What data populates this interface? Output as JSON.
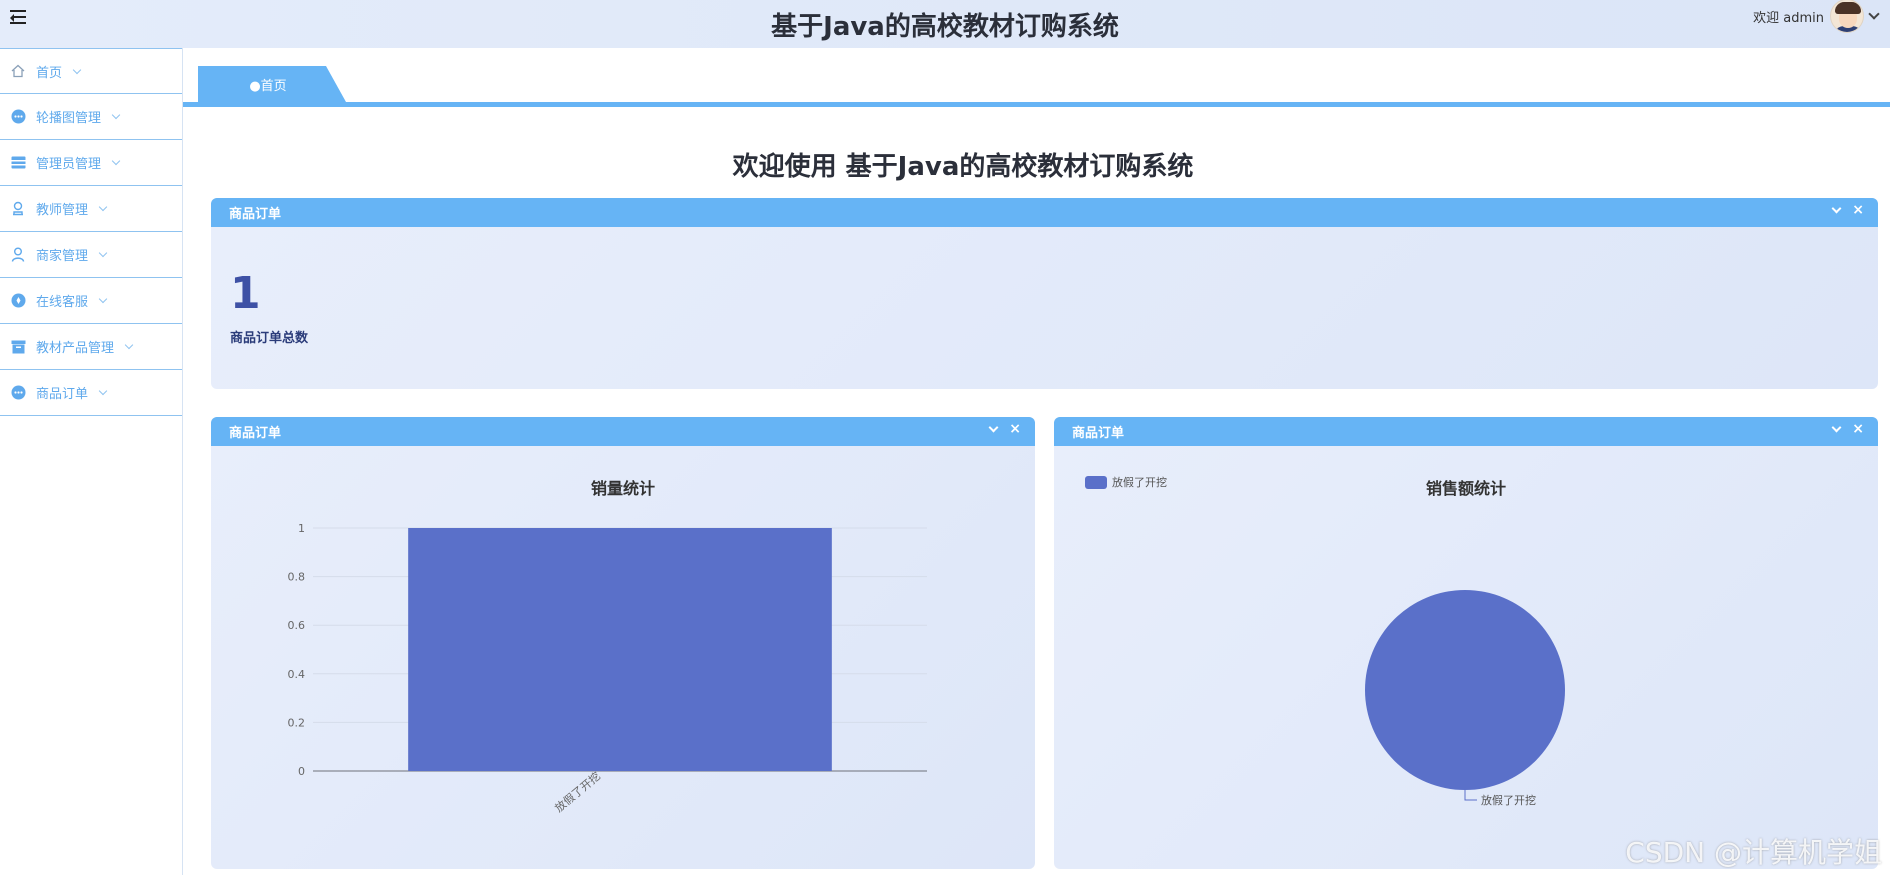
{
  "header": {
    "title": "基于Java的高校教材订购系统",
    "welcome": "欢迎 admin"
  },
  "sidebar": {
    "items": [
      {
        "label": "首页",
        "icon": "home-icon"
      },
      {
        "label": "轮播图管理",
        "icon": "more-circle-icon"
      },
      {
        "label": "管理员管理",
        "icon": "card-icon"
      },
      {
        "label": "教师管理",
        "icon": "user-stamp-icon"
      },
      {
        "label": "商家管理",
        "icon": "user-icon"
      },
      {
        "label": "在线客服",
        "icon": "service-icon"
      },
      {
        "label": "教材产品管理",
        "icon": "box-icon"
      },
      {
        "label": "商品订单",
        "icon": "more-circle-icon"
      }
    ]
  },
  "tabs": [
    {
      "label": "●首页"
    }
  ],
  "main": {
    "welcome_title": "欢迎使用 基于Java的高校教材订购系统",
    "stat_panel": {
      "title": "商品订单",
      "value": "1",
      "label": "商品订单总数"
    },
    "bar_panel": {
      "title": "商品订单",
      "chart_title": "销量统计"
    },
    "pie_panel": {
      "title": "商品订单",
      "chart_title": "销售额统计",
      "legend": "放假了开挖",
      "slice_label": "放假了开挖"
    }
  },
  "colors": {
    "accent": "#66b4f5",
    "series": "#5a70c9"
  },
  "chart_data": [
    {
      "type": "bar",
      "title": "销量统计",
      "categories": [
        "放假了开挖"
      ],
      "values": [
        1
      ],
      "ylim": [
        0,
        1
      ],
      "yticks": [
        "0",
        "0.2",
        "0.4",
        "0.6",
        "0.8",
        "1"
      ],
      "grid": true
    },
    {
      "type": "pie",
      "title": "销售额统计",
      "labels": [
        "放假了开挖"
      ],
      "values": [
        1
      ],
      "legend_position": "top-left"
    }
  ],
  "watermark": "CSDN @计算机学姐"
}
